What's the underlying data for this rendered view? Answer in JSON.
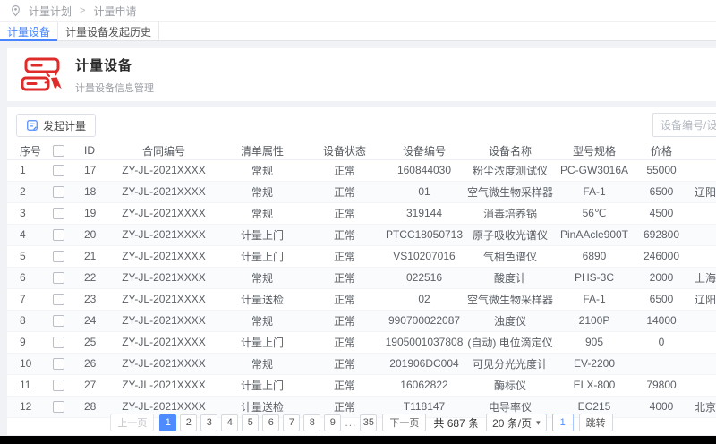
{
  "breadcrumb": {
    "items": [
      "计量计划",
      "计量申请"
    ],
    "separator": ">"
  },
  "tabs": [
    {
      "label": "计量设备",
      "active": true
    },
    {
      "label": "计量设备发起历史",
      "active": false
    }
  ],
  "header": {
    "title": "计量设备",
    "subtitle": "计量设备信息管理"
  },
  "toolbar": {
    "launch_button": "发起计量",
    "search_placeholder": "设备编号/设备名称",
    "search_value": ""
  },
  "table": {
    "columns": [
      "序号",
      "ID",
      "合同编号",
      "清单属性",
      "设备状态",
      "设备编号",
      "设备名称",
      "型号规格",
      "价格"
    ],
    "rows": [
      {
        "no": "1",
        "id": "17",
        "contract": "ZY-JL-2021XXXX",
        "attr": "常规",
        "status": "正常",
        "device_no": "160844030",
        "name": "粉尘浓度测试仪",
        "model": "PC-GW3016A",
        "price": "55000",
        "vendor": ""
      },
      {
        "no": "2",
        "id": "18",
        "contract": "ZY-JL-2021XXXX",
        "attr": "常规",
        "status": "正常",
        "device_no": "01",
        "name": "空气微生物采样器",
        "model": "FA-1",
        "price": "6500",
        "vendor": "辽阳"
      },
      {
        "no": "3",
        "id": "19",
        "contract": "ZY-JL-2021XXXX",
        "attr": "常规",
        "status": "正常",
        "device_no": "319144",
        "name": "消毒培养锅",
        "model": "56℃",
        "price": "4500",
        "vendor": ""
      },
      {
        "no": "4",
        "id": "20",
        "contract": "ZY-JL-2021XXXX",
        "attr": "计量上门",
        "status": "正常",
        "device_no": "PTCC18050713",
        "name": "原子吸收光谱仪",
        "model": "PinAAcle900T",
        "price": "692800",
        "vendor": ""
      },
      {
        "no": "5",
        "id": "21",
        "contract": "ZY-JL-2021XXXX",
        "attr": "计量上门",
        "status": "正常",
        "device_no": "VS10207016",
        "name": "气相色谱仪",
        "model": "6890",
        "price": "246000",
        "vendor": ""
      },
      {
        "no": "6",
        "id": "22",
        "contract": "ZY-JL-2021XXXX",
        "attr": "常规",
        "status": "正常",
        "device_no": "022516",
        "name": "酸度计",
        "model": "PHS-3C",
        "price": "2000",
        "vendor": "上海精"
      },
      {
        "no": "7",
        "id": "23",
        "contract": "ZY-JL-2021XXXX",
        "attr": "计量送检",
        "status": "正常",
        "device_no": "02",
        "name": "空气微生物采样器",
        "model": "FA-1",
        "price": "6500",
        "vendor": "辽阳"
      },
      {
        "no": "8",
        "id": "24",
        "contract": "ZY-JL-2021XXXX",
        "attr": "常规",
        "status": "正常",
        "device_no": "990700022087",
        "name": "浊度仪",
        "model": "2100P",
        "price": "14000",
        "vendor": ""
      },
      {
        "no": "9",
        "id": "25",
        "contract": "ZY-JL-2021XXXX",
        "attr": "计量上门",
        "status": "正常",
        "device_no": "1905001037808",
        "name": "(自动) 电位滴定仪",
        "model": "905",
        "price": "0",
        "vendor": ""
      },
      {
        "no": "10",
        "id": "26",
        "contract": "ZY-JL-2021XXXX",
        "attr": "常规",
        "status": "正常",
        "device_no": "201906DC004",
        "name": "可见分光光度计",
        "model": "EV-2200",
        "price": "",
        "vendor": ""
      },
      {
        "no": "11",
        "id": "27",
        "contract": "ZY-JL-2021XXXX",
        "attr": "计量上门",
        "status": "正常",
        "device_no": "16062822",
        "name": "酶标仪",
        "model": "ELX-800",
        "price": "79800",
        "vendor": ""
      },
      {
        "no": "12",
        "id": "28",
        "contract": "ZY-JL-2021XXXX",
        "attr": "计量送检",
        "status": "正常",
        "device_no": "T118147",
        "name": "电导率仪",
        "model": "EC215",
        "price": "4000",
        "vendor": "北京驰"
      }
    ]
  },
  "pagination": {
    "prev": "上一页",
    "next": "下一页",
    "pages": [
      "1",
      "2",
      "3",
      "4",
      "5",
      "6",
      "7",
      "8",
      "9",
      "...",
      "35"
    ],
    "active_page": "1",
    "total_text": "共 687 条",
    "page_size": "20 条/页",
    "jump_value": "1",
    "jump_button": "跳转"
  },
  "colors": {
    "accent": "#4a86ff",
    "active_page_bg": "#4e8bff",
    "header_icon_red": "#e02b2b"
  }
}
